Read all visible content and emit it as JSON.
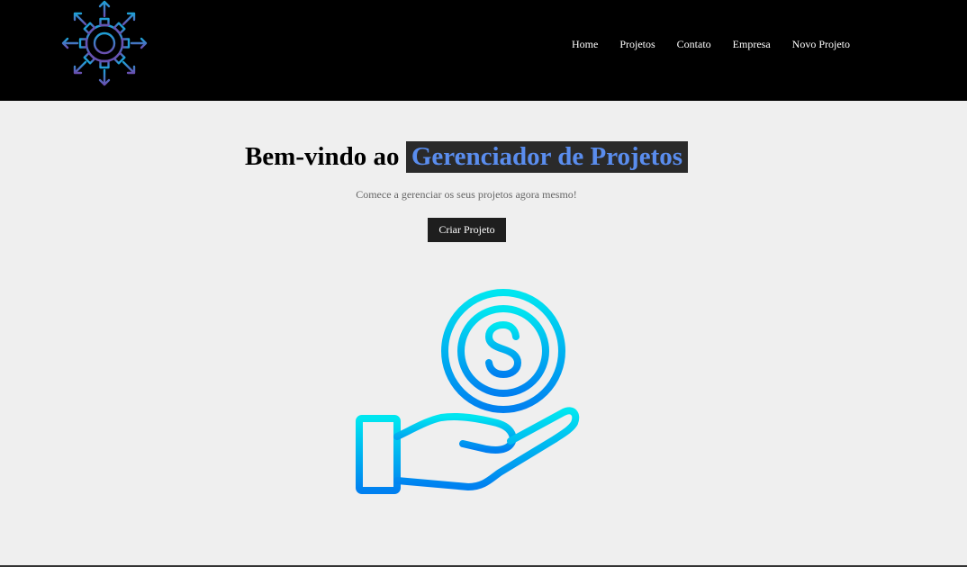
{
  "logo": {
    "icon": "gear-with-arrows-icon"
  },
  "nav": {
    "items": [
      {
        "label": "Home"
      },
      {
        "label": "Projetos"
      },
      {
        "label": "Contato"
      },
      {
        "label": "Empresa"
      },
      {
        "label": "Novo Projeto"
      }
    ]
  },
  "hero": {
    "title_prefix": "Bem-vindo ao",
    "title_highlight": "Gerenciador de Projetos",
    "subtitle": "Comece a gerenciar os seus projetos agora mesmo!",
    "cta_label": "Criar Projeto"
  },
  "illustration": {
    "icon": "hand-holding-dollar-coin-icon"
  },
  "colors": {
    "header_bg": "#000000",
    "page_bg": "#efefef",
    "highlight_text": "#5a8dee",
    "highlight_bg": "#2a2a2a",
    "button_bg": "#1e1e1e",
    "icon_gradient_start": "#00e6f0",
    "icon_gradient_end": "#0080f0"
  }
}
